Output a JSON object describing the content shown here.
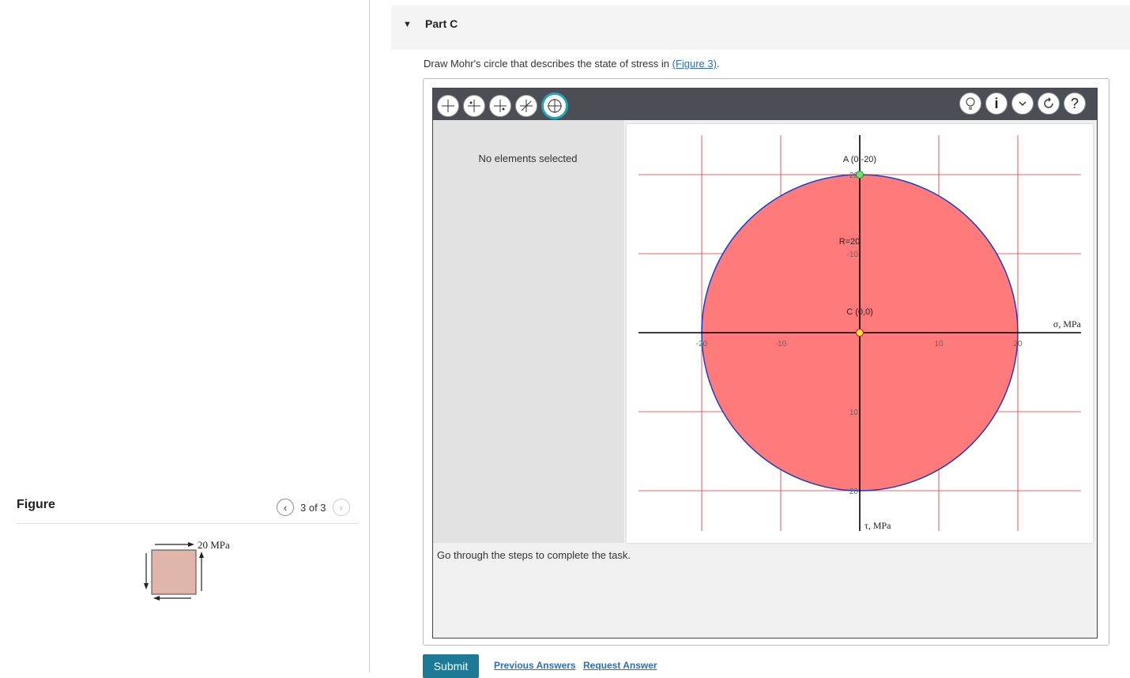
{
  "figure_panel": {
    "title": "Figure",
    "pager_text": "3 of 3",
    "stress_label": "20 MPa"
  },
  "part": {
    "caret": "▼",
    "label": "Part C",
    "prompt_text": "Draw Mohr's circle that describes the state of stress in ",
    "prompt_link": "(Figure 3)",
    "prompt_end": "."
  },
  "tool": {
    "no_selection": "No elements selected",
    "steps_text": "Go through the steps to complete the task.",
    "toolbar_left_icons": [
      "sigma-x-axis-icon",
      "sigma-y-axis-icon",
      "shear-axis-icon",
      "rotation-axis-icon",
      "circle-tool-icon"
    ],
    "toolbar_right_icons": [
      "hint-bulb-icon",
      "info-icon",
      "dropdown-chevron-icon",
      "reset-icon",
      "help-icon"
    ]
  },
  "graph": {
    "point_a_label": "A (0,-20)",
    "radius_label": "R=20",
    "center_label": "C (0,0)",
    "sigma_axis_label": "σ, MPa",
    "tau_axis_label": "τ, MPa",
    "x_ticks": [
      "-20",
      "-10",
      "10",
      "20"
    ],
    "y_ticks": [
      "-20",
      "-10",
      "10",
      "20"
    ],
    "circle_fill": "#ff7b7b",
    "circle_stroke": "#1a3fc8",
    "grid_color": "#e03030",
    "center_sigma": 0,
    "center_tau": 0,
    "radius": 20
  },
  "actions": {
    "submit": "Submit",
    "previous_answers": "Previous Answers",
    "request_answer": "Request Answer"
  },
  "colors": {
    "submit_bg": "#1c7a97",
    "link": "#2a6ebb",
    "active_tool": "#1ea5b5"
  }
}
